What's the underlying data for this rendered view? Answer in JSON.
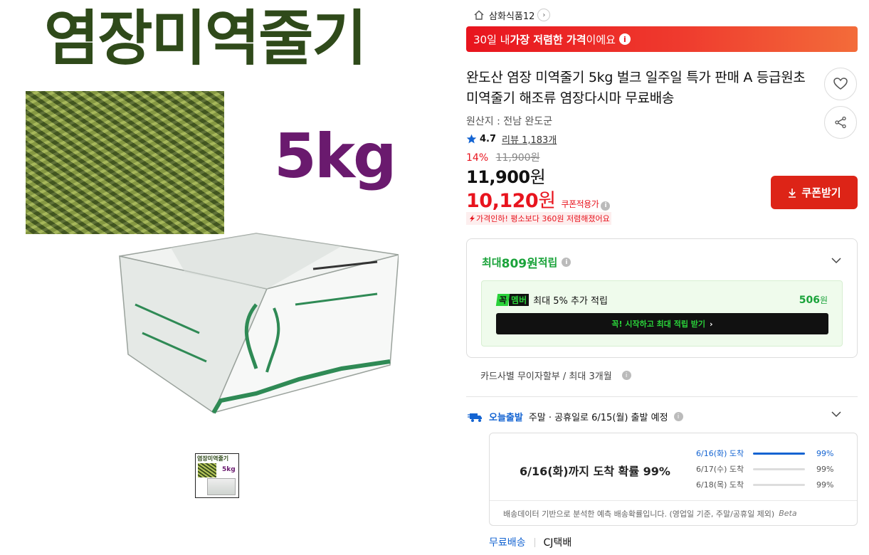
{
  "image": {
    "title": "염장미역줄기",
    "weight": "5kg",
    "thumb_title": "염장미역줄기",
    "thumb_weight": "5kg"
  },
  "store": {
    "name": "삼화식품12"
  },
  "banner": {
    "prefix": "30일 내 ",
    "bold": "가장 저렴한 가격",
    "suffix": "이에요",
    "color": "#e8141e"
  },
  "product": {
    "title": "완도산 염장 미역줄기 5kg 벌크 일주일 특가 판매 A 등급원초 미역줄기 해조류 염장다시마 무료배송",
    "origin": "원산지 : 전남 완도군",
    "rating": "4.7",
    "review_label": "리뷰",
    "review_count": "1,183개",
    "discount_pct": "14%",
    "original_price": "11,900원",
    "price_num": "11,900",
    "price_unit": "원",
    "coupon_price_num": "10,120",
    "coupon_price_unit": "원",
    "coupon_label": "쿠폰적용가",
    "price_drop_note": "가격인하! 평소보다 360원 저렴해졌어요",
    "coupon_button": "쿠폰받기"
  },
  "points": {
    "prefix": "최대 ",
    "amount": "809원",
    "suffix": " 적립",
    "member_badge_k": "꼭",
    "member_badge_m": "멤버",
    "member_text": "최대 5% 추가 적립",
    "member_amount": "506",
    "member_amount_unit": "원",
    "member_button": "꼭! 시작하고 최대 적립 받기",
    "accent": "#1aa33a"
  },
  "card": {
    "text": "카드사별 무이자할부 / 최대 3개월"
  },
  "shipping": {
    "today_label": "오늘출발",
    "schedule": "주말 · 공휴일로 6/15(월) 출발 예정",
    "prediction_main": "6/16(화)까지 도착 확률 99%",
    "rows": [
      {
        "date": "6/16(화) 도착",
        "pct": "99%",
        "fill": 1.0
      },
      {
        "date": "6/17(수) 도착",
        "pct": "99%",
        "fill": 0.0
      },
      {
        "date": "6/18(목) 도착",
        "pct": "99%",
        "fill": 0.0
      }
    ],
    "footnote": "배송데이터 기반으로 분석한 예측 배송확률입니다. (영업일 기준, 주말/공휴일 제외)",
    "beta": "Beta",
    "free_shipping": "무료배송",
    "carrier": "CJ택배",
    "accent": "#1464d2"
  }
}
